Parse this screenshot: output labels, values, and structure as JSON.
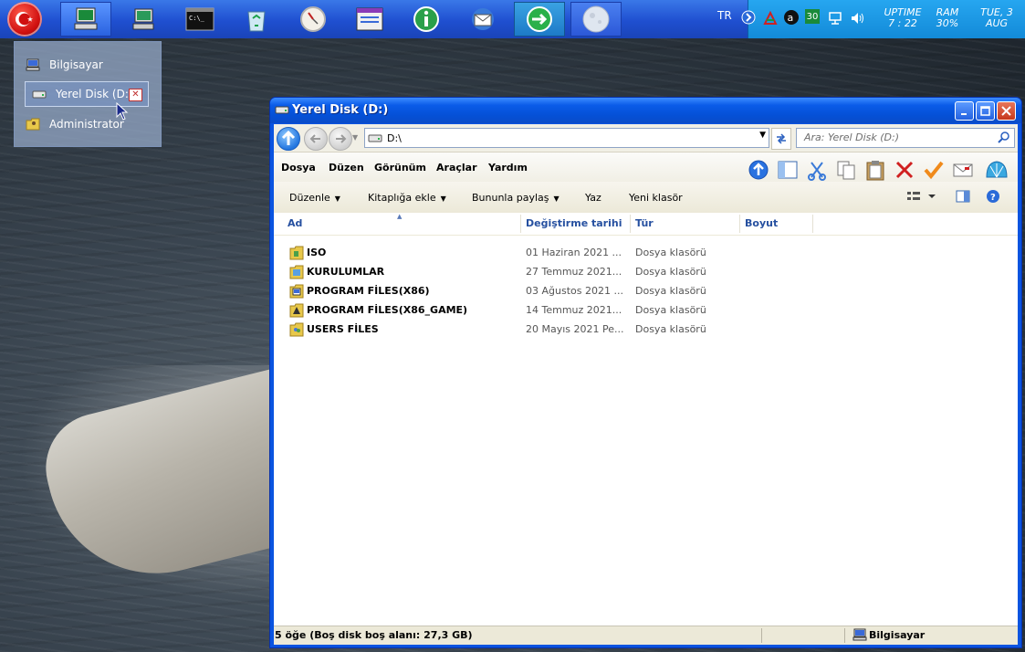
{
  "taskbar": {
    "start_icon": "turkish-flag-icon",
    "apps": [
      "computer-icon",
      "network-computer-icon",
      "command-prompt-icon",
      "recycle-bin-icon",
      "clock-icon",
      "window-app-icon",
      "info-icon",
      "mail-icon",
      "globe-arrow-icon",
      "moon-icon"
    ],
    "language": "TR",
    "counter_badge": "30",
    "uptime_label": "UPTIME",
    "uptime_value": "7 : 22",
    "ram_label": "RAM",
    "ram_value": "30%",
    "date_line1": "TUE, 3",
    "date_line2": "AUG"
  },
  "popup": {
    "items": [
      {
        "label": "Bilgisayar",
        "icon": "computer-icon"
      },
      {
        "label": "Yerel Disk (D:)",
        "icon": "drive-icon"
      },
      {
        "label": "Administrator",
        "icon": "user-folder-icon"
      }
    ]
  },
  "window": {
    "title": "Yerel Disk (D:)",
    "address": "D:\\",
    "search_placeholder": "Ara: Yerel Disk (D:)",
    "menu": [
      "Dosya",
      "Düzen",
      "Görünüm",
      "Araçlar",
      "Yardım"
    ],
    "commands": [
      "Düzenle",
      "Kitaplığa ekle",
      "Bununla paylaş",
      "Yaz",
      "Yeni klasör"
    ],
    "columns": [
      "Ad",
      "Değiştirme tarihi",
      "Tür",
      "Boyut"
    ],
    "files": [
      {
        "name": "ISO",
        "date": "01 Haziran 2021 ...",
        "type": "Dosya klasörü"
      },
      {
        "name": "KURULUMLAR",
        "date": "27 Temmuz 2021...",
        "type": "Dosya klasörü"
      },
      {
        "name": "PROGRAM FİLES(X86)",
        "date": "03 Ağustos 2021 ...",
        "type": "Dosya klasörü"
      },
      {
        "name": "PROGRAM FİLES(X86_GAME)",
        "date": "14 Temmuz 2021...",
        "type": "Dosya klasörü"
      },
      {
        "name": "USERS FİLES",
        "date": "20 Mayıs 2021 Pe...",
        "type": "Dosya klasörü"
      }
    ],
    "status_left": "5 öğe (Boş disk boş alanı: 27,3 GB)",
    "status_right": "Bilgisayar"
  },
  "colors": {
    "titlebar": "#0a5be8",
    "taskbar": "#1f4fd0",
    "tray": "#138ad8"
  }
}
